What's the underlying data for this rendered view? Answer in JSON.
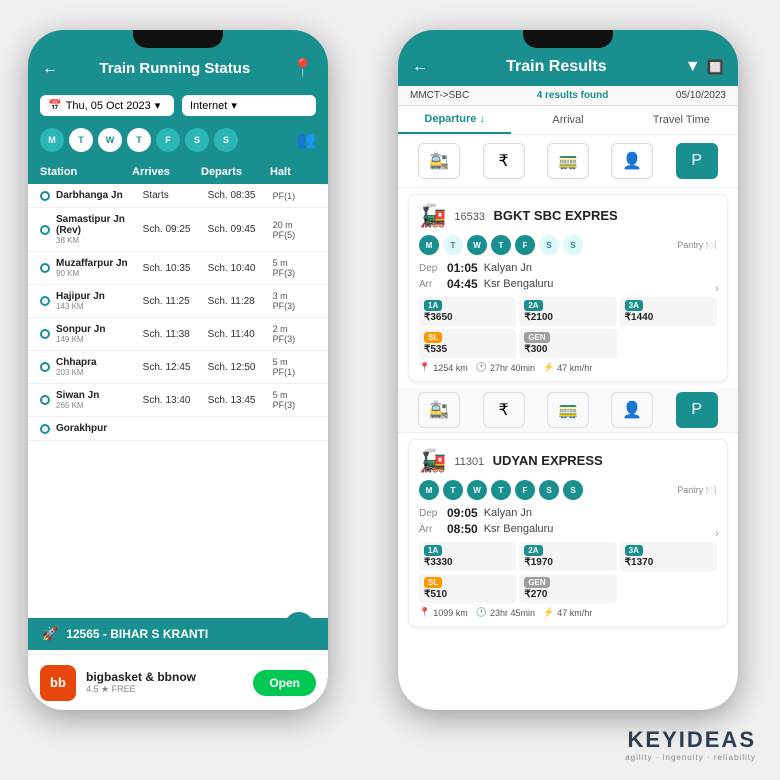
{
  "left_phone": {
    "header": {
      "title": "Train Running Status",
      "back_label": "←",
      "location_icon": "📍"
    },
    "date": "Thu, 05 Oct 2023",
    "source": "Internet",
    "days": [
      "M",
      "T",
      "W",
      "T",
      "F",
      "S",
      "S"
    ],
    "active_day_index": 3,
    "table": {
      "columns": [
        "Station",
        "Arrives",
        "Departs",
        "Halt"
      ],
      "rows": [
        {
          "name": "Darbhanga Jn",
          "km": "",
          "arrives": "Starts",
          "departs": "Sch. 08:35",
          "halt": "PF(1)",
          "halt_time": ""
        },
        {
          "name": "Samastipur Jn (Rev)",
          "km": "38 KM",
          "arrives": "Sch. 09:25",
          "departs": "Sch. 09:45",
          "halt": "PF(5)",
          "halt_time": "20 m"
        },
        {
          "name": "Muzaffarpur Jn",
          "km": "90 KM",
          "arrives": "Sch. 10:35",
          "departs": "Sch. 10:40",
          "halt": "PF(3)",
          "halt_time": "5 m"
        },
        {
          "name": "Hajipur Jn",
          "km": "143 KM",
          "arrives": "Sch. 11:25",
          "departs": "Sch. 11:28",
          "halt": "PF(3)",
          "halt_time": "3 m"
        },
        {
          "name": "Sonpur Jn",
          "km": "149 KM",
          "arrives": "Sch. 11:38",
          "departs": "Sch. 11:40",
          "halt": "PF(3)",
          "halt_time": "2 m"
        },
        {
          "name": "Chhapra",
          "km": "203 KM",
          "arrives": "Sch. 12:45",
          "departs": "Sch. 12:50",
          "halt": "PF(1)",
          "halt_time": "5 m"
        },
        {
          "name": "Siwan Jn",
          "km": "265 KM",
          "arrives": "Sch. 13:40",
          "departs": "Sch. 13:45",
          "halt": "PF(3)",
          "halt_time": "5 m"
        },
        {
          "name": "Gorakhpur",
          "km": "",
          "arrives": "",
          "departs": "",
          "halt": "",
          "halt_time": ""
        }
      ]
    },
    "train_footer": "12565 - BIHAR S KRANTI",
    "ad": {
      "name": "bigbasket & bbnow",
      "rating": "4.5 ★  FREE",
      "btn_label": "Open"
    }
  },
  "right_phone": {
    "header": {
      "title": "Train Results",
      "back_label": "←",
      "filter_icon": "▼",
      "scan_icon": "🔲"
    },
    "subheader": {
      "route": "MMCT->SBC",
      "results": "4 results found",
      "date": "05/10/2023"
    },
    "sort_tabs": [
      {
        "label": "Departure ↓",
        "active": true
      },
      {
        "label": "Arrival"
      },
      {
        "label": "Travel Time"
      }
    ],
    "filter_icons": [
      "🚉",
      "₹",
      "🚃",
      "👤",
      "P"
    ],
    "trains": [
      {
        "number": "16533",
        "name": "BGKT SBC EXPRES",
        "icon": "🚂",
        "days": [
          "M",
          "T",
          "W",
          "T",
          "F",
          "S",
          "S"
        ],
        "active_days": [
          0,
          2,
          3,
          4
        ],
        "pantry": true,
        "dep_time": "01:05",
        "dep_station": "Kalyan Jn",
        "arr_time": "04:45",
        "arr_station": "Ksr Bengaluru",
        "fares": [
          {
            "class": "1A",
            "amount": "₹3650"
          },
          {
            "class": "2A",
            "amount": "₹2100"
          },
          {
            "class": "3A",
            "amount": "₹1440"
          },
          {
            "class": "SL",
            "amount": "₹535"
          },
          {
            "class": "GEN",
            "amount": "₹300"
          }
        ],
        "distance": "1254 km",
        "duration": "27hr 40min",
        "speed": "47 km/hr"
      },
      {
        "number": "11301",
        "name": "UDYAN EXPRESS",
        "icon": "🚂",
        "days": [
          "M",
          "T",
          "W",
          "T",
          "F",
          "S",
          "S"
        ],
        "active_days": [
          0,
          1,
          2,
          3,
          4,
          5,
          6
        ],
        "pantry": true,
        "dep_time": "09:05",
        "dep_station": "Kalyan Jn",
        "arr_time": "08:50",
        "arr_station": "Ksr Bengaluru",
        "fares": [
          {
            "class": "1A",
            "amount": "₹3330"
          },
          {
            "class": "2A",
            "amount": "₹1970"
          },
          {
            "class": "3A",
            "amount": "₹1370"
          },
          {
            "class": "SL",
            "amount": "₹510"
          },
          {
            "class": "GEN",
            "amount": "₹270"
          }
        ],
        "distance": "1099 km",
        "duration": "23hr 45min",
        "speed": "47 km/hr"
      }
    ]
  },
  "watermark": {
    "brand": "KEYIDEAS",
    "sub": "agility · ingenuity · reliability"
  }
}
